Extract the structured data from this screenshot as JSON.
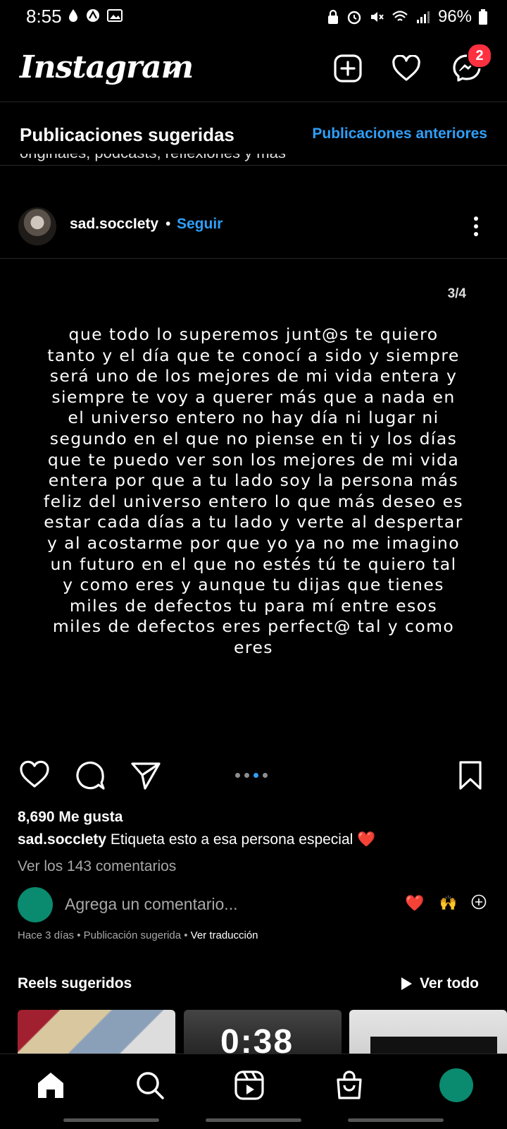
{
  "status_bar": {
    "time": "8:55",
    "battery": "96%"
  },
  "header": {
    "logo": "Instagram",
    "dm_badge": "2"
  },
  "suggested": {
    "title": "Publicaciones sugeridas",
    "previous_link": "Publicaciones anteriores",
    "cut_text": "originales, podcasts, reflexiones y más"
  },
  "post": {
    "username": "sad.soccIety",
    "follow": "Seguir",
    "separator": "•",
    "page_counter": "3/4",
    "text": "que todo lo superemos junt@s te quiero tanto y el día que te conocí a sido y siempre será uno de los mejores de mi vida entera y siempre te voy a querer más que a nada en el universo entero no hay día ni lugar ni segundo en el que no piense en ti y los días que te puedo ver son los mejores de mi vida entera por que a tu lado soy la persona más feliz del universo entero lo que más deseo es estar cada días a tu lado y verte al despertar y al acostarme por que yo ya no me imagino un futuro en el que no estés tú te quiero tal y como eres y aunque tu dijas que tienes miles de defectos tu para mí entre esos miles de defectos eres perfect@ tal y como eres",
    "likes": "8,690 Me gusta",
    "caption_user": "sad.soccIety",
    "caption_text": "Etiqueta esto a esa persona especial",
    "caption_emoji": "❤️",
    "view_comments": "Ver los 143 comentarios",
    "comment_placeholder": "Agrega un comentario...",
    "quick_reactions": [
      "❤️",
      "🙌"
    ],
    "meta": "Hace 3 días • Publicación sugerida • ",
    "translate": "Ver traducción",
    "carousel_active_index": 3,
    "carousel_count": 4
  },
  "reels": {
    "title": "Reels sugeridos",
    "see_all": "Ver todo",
    "reel_2_overlay": "0:38"
  },
  "colors": {
    "accent": "#2f9ff8",
    "badge": "#ff3040",
    "avatar": "#0a8a6e"
  }
}
